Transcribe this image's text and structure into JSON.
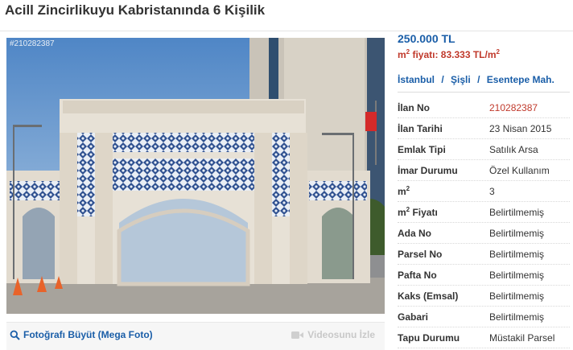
{
  "listing": {
    "title": "Acill Zincirlikuyu Kabristanında 6 Kişilik"
  },
  "photo": {
    "id_watermark": "#210282387"
  },
  "photo_links": {
    "mega_photo": "Fotoğrafı Büyüt (Mega Foto)",
    "video": "Videosunu İzle",
    "mega_icon": "search-icon",
    "video_icon": "video-camera-icon"
  },
  "price": {
    "amount": "250.000 TL",
    "sqm_label": "m",
    "sqm_sup": "2",
    "sqm_text": " fiyatı: 83.333 TL/m",
    "sqm_sup2": "2"
  },
  "location": {
    "city": "İstanbul",
    "district": "Şişli",
    "neighborhood": "Esentepe Mah.",
    "separator": "/"
  },
  "details": [
    {
      "key": "İlan No",
      "value": "210282387",
      "highlight": true
    },
    {
      "key": "İlan Tarihi",
      "value": "23 Nisan 2015"
    },
    {
      "key": "Emlak Tipi",
      "value": "Satılık Arsa"
    },
    {
      "key": "İmar Durumu",
      "value": "Özel Kullanım"
    },
    {
      "key": "m",
      "key_sup": "2",
      "value": "3"
    },
    {
      "key": "m",
      "key_sup": "2",
      "key_suffix": " Fiyatı",
      "value": "Belirtilmemiş"
    },
    {
      "key": "Ada No",
      "value": "Belirtilmemiş"
    },
    {
      "key": "Parsel No",
      "value": "Belirtilmemiş"
    },
    {
      "key": "Pafta No",
      "value": "Belirtilmemiş"
    },
    {
      "key": "Kaks (Emsal)",
      "value": "Belirtilmemiş"
    },
    {
      "key": "Gabari",
      "value": "Belirtilmemiş"
    },
    {
      "key": "Tapu Durumu",
      "value": "Müstakil Parsel"
    }
  ],
  "colors": {
    "link_blue": "#1a5ea8",
    "price_red": "#c0392b"
  }
}
